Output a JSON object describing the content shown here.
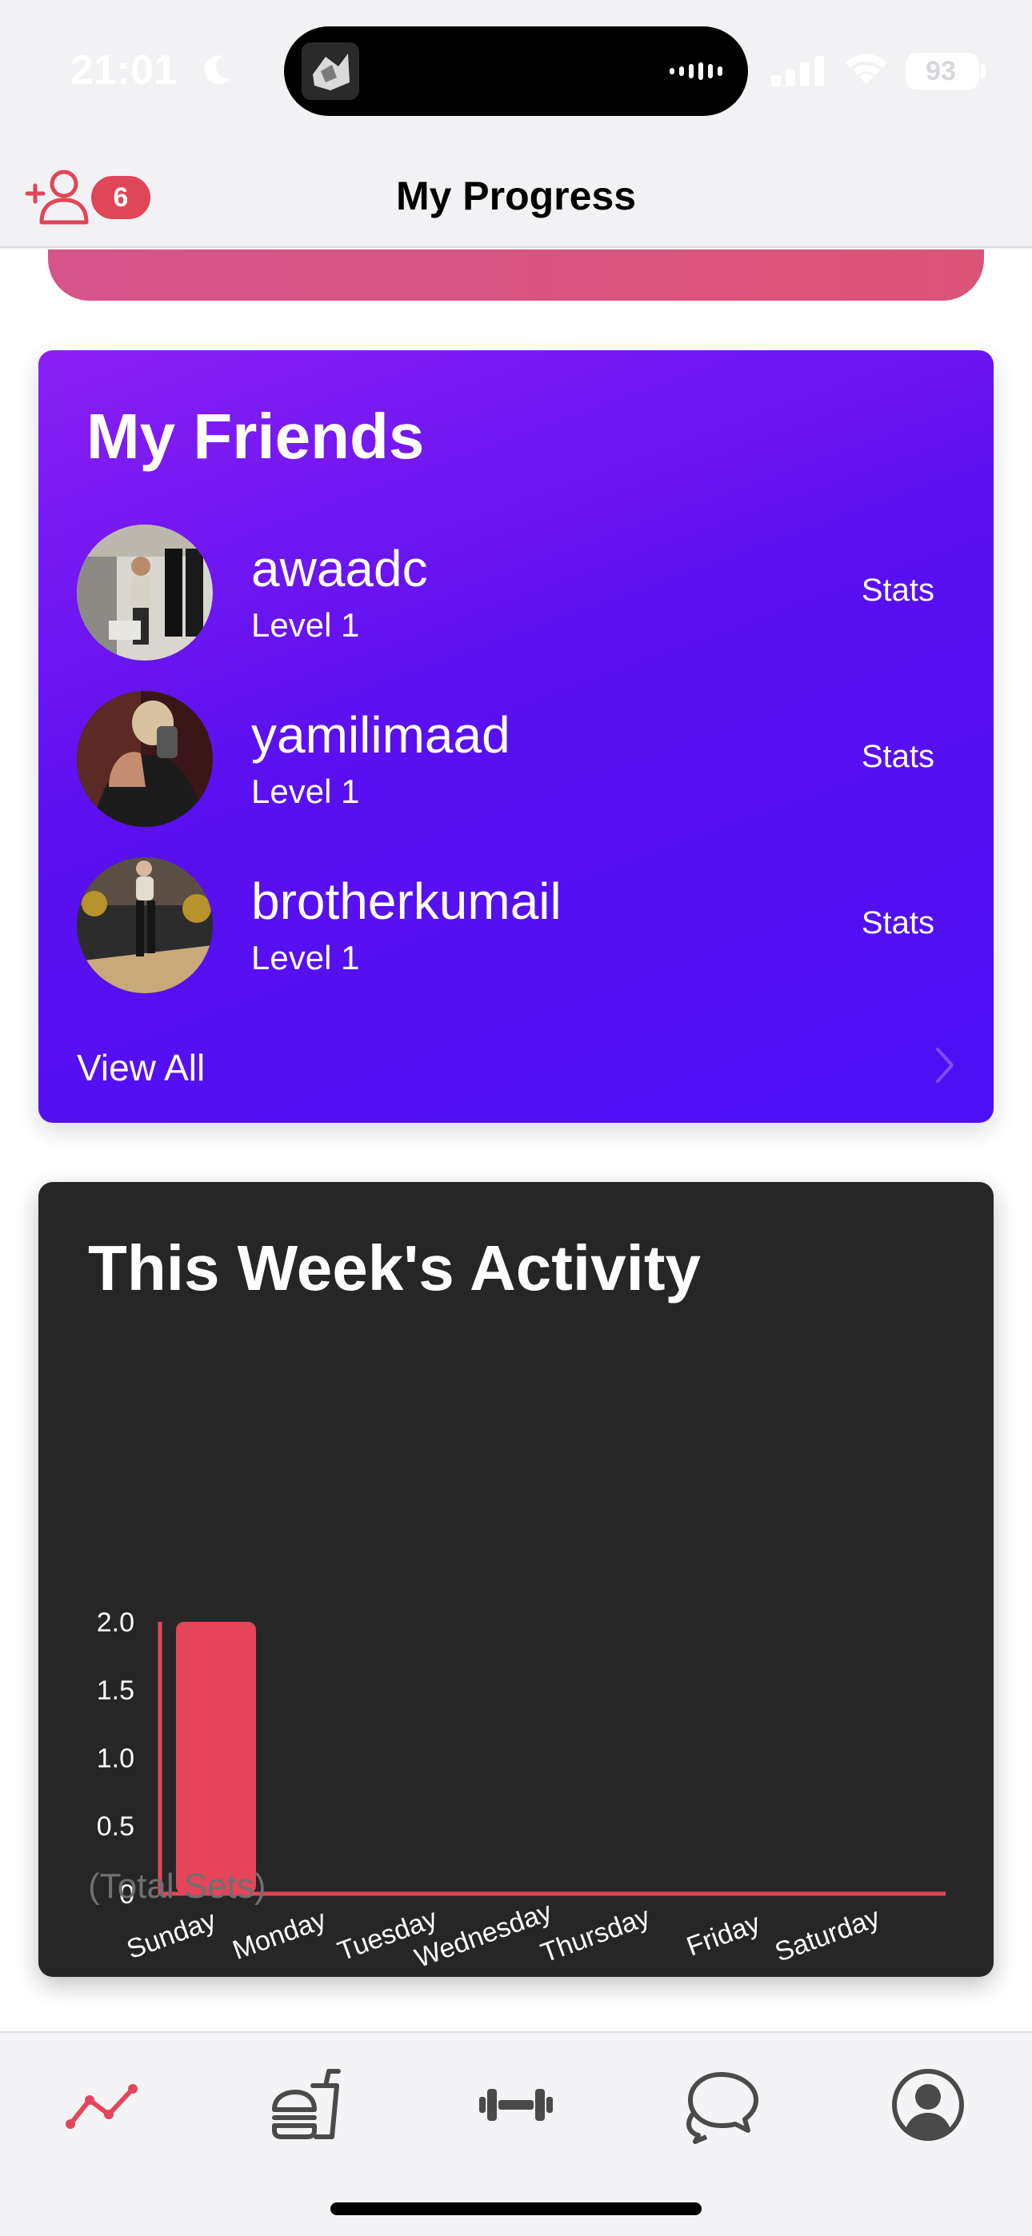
{
  "status_bar": {
    "time": "21:01",
    "battery": "93"
  },
  "header": {
    "title": "My Progress",
    "friend_request_count": "6"
  },
  "colors": {
    "accent": "#e5455a",
    "friends_gradient_start": "#8a1ff3",
    "friends_gradient_end": "#4d0ff5",
    "activity_card_bg": "#262626"
  },
  "friends": {
    "title": "My Friends",
    "items": [
      {
        "name": "awaadc",
        "level": "Level 1",
        "action": "Stats"
      },
      {
        "name": "yamilimaad",
        "level": "Level 1",
        "action": "Stats"
      },
      {
        "name": "brotherkumail",
        "level": "Level 1",
        "action": "Stats"
      }
    ],
    "view_all": "View All"
  },
  "activity": {
    "title": "This Week's Activity",
    "unit_label": "(Total Sets)"
  },
  "chart_data": {
    "type": "bar",
    "title": "This Week's Activity",
    "categories": [
      "Sunday",
      "Monday",
      "Tuesday",
      "Wednesday",
      "Thursday",
      "Friday",
      "Saturday"
    ],
    "values": [
      2,
      0,
      0,
      0,
      0,
      0,
      0
    ],
    "y_ticks": [
      "0",
      "0.5",
      "1.0",
      "1.5",
      "2.0"
    ],
    "ylim": [
      0,
      2
    ],
    "ylabel": "(Total Sets)",
    "xlabel": "",
    "grid": false,
    "bar_color": "#e5455a"
  },
  "tabs": [
    {
      "name": "progress",
      "icon": "progress-chart-icon",
      "active": true
    },
    {
      "name": "nutrition",
      "icon": "food-drink-icon",
      "active": false
    },
    {
      "name": "workout",
      "icon": "dumbbell-icon",
      "active": false
    },
    {
      "name": "chat",
      "icon": "chat-bubbles-icon",
      "active": false
    },
    {
      "name": "profile",
      "icon": "profile-icon",
      "active": false
    }
  ]
}
